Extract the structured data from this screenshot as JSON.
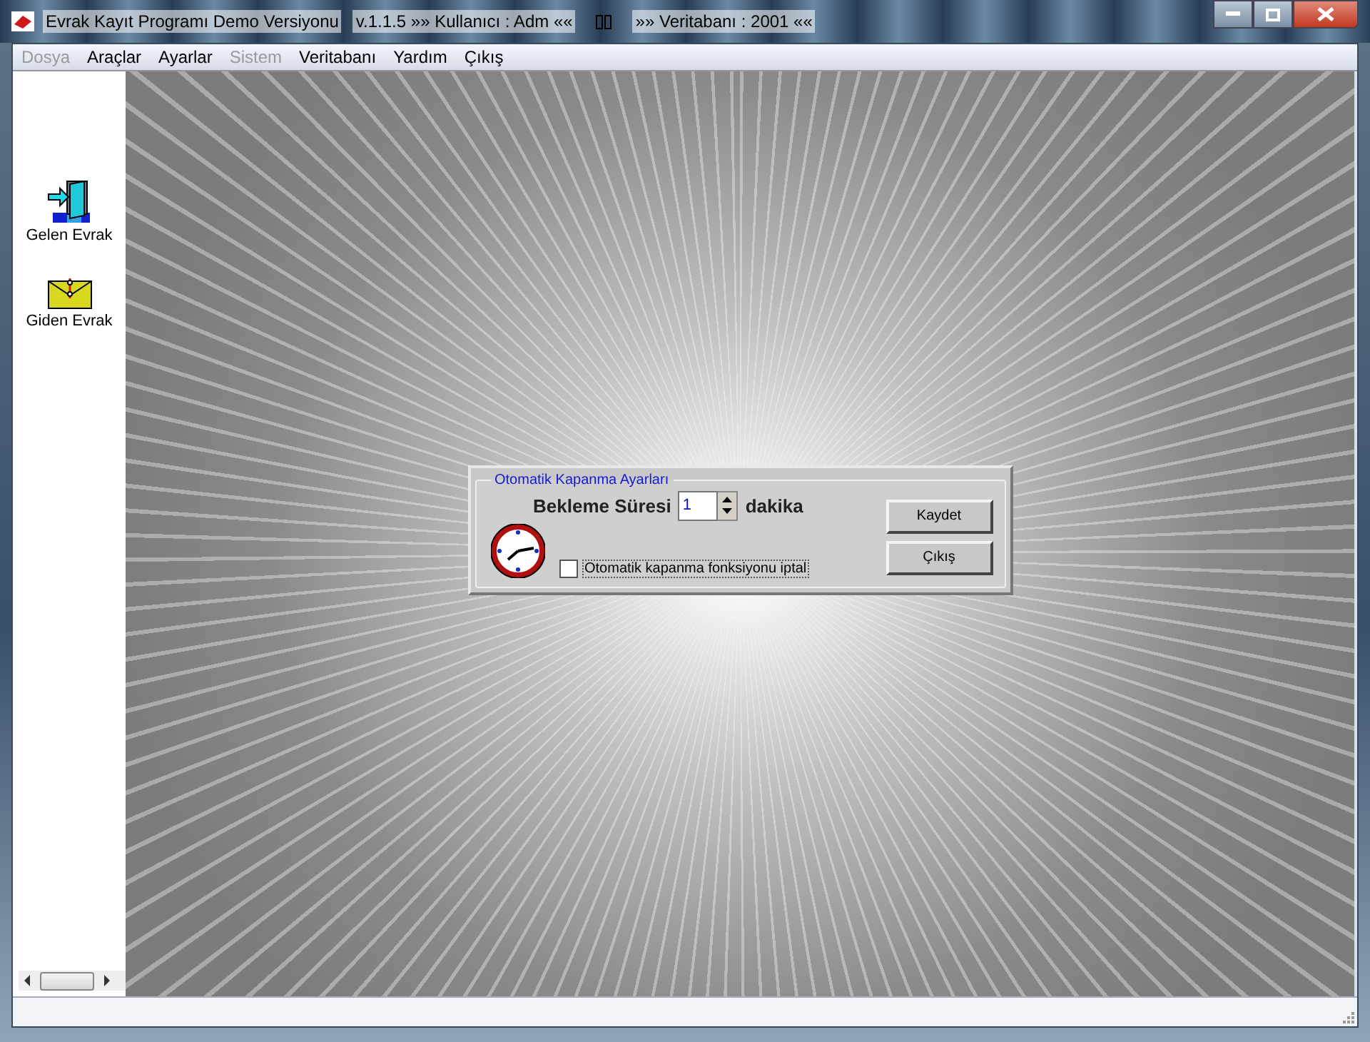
{
  "window": {
    "title": "Evrak Kayıt Programı Demo Versiyonu",
    "info_left": "v.1.1.5 »»  Kullanıcı : Adm ««",
    "info_right": "»»  Veritabanı : 2001 ««"
  },
  "menu": [
    {
      "label": "Dosya",
      "disabled": true
    },
    {
      "label": "Araçlar",
      "disabled": false
    },
    {
      "label": "Ayarlar",
      "disabled": false
    },
    {
      "label": "Sistem",
      "disabled": true
    },
    {
      "label": "Veritabanı",
      "disabled": false
    },
    {
      "label": "Yardım",
      "disabled": false
    },
    {
      "label": "Çıkış",
      "disabled": false
    }
  ],
  "sidebar": {
    "items": [
      {
        "label": "Gelen Evrak",
        "kind": "incoming"
      },
      {
        "label": "Giden Evrak",
        "kind": "outgoing"
      }
    ]
  },
  "dialog": {
    "group_title": "Otomatik Kapanma Ayarları",
    "wait_label": "Bekleme Süresi",
    "wait_value": "1",
    "unit": "dakika",
    "checkbox": {
      "label": "Otomatik kapanma fonksiyonu iptal",
      "checked": false
    },
    "buttons": [
      "Kaydet",
      "Çıkış"
    ]
  }
}
